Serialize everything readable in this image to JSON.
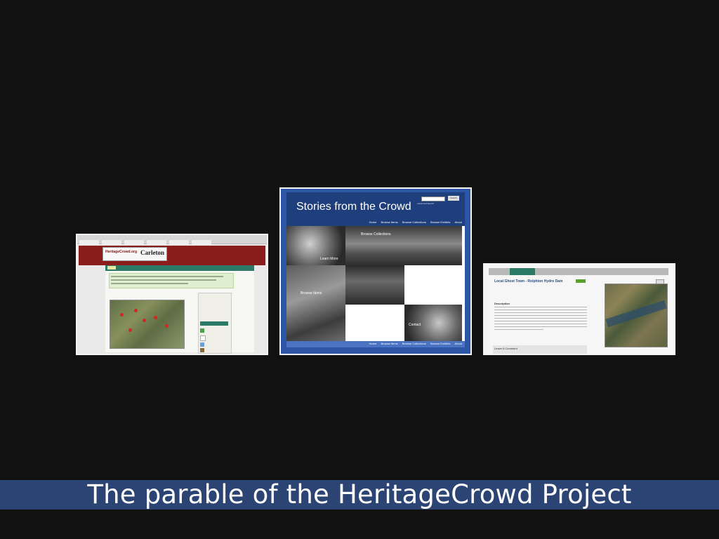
{
  "slide": {
    "caption": "The parable of the HeritageCrowd Project",
    "background_color": "#111111",
    "caption_bar_color": "#2b4474"
  },
  "left_screenshot": {
    "logo_left": "HeritageCrowd.org",
    "logo_right": "Carleton",
    "banner_color": "#8c1d1d",
    "nav_color": "#2b7a66"
  },
  "middle_screenshot": {
    "title": "Stories from the Crowd",
    "search_button": "Search",
    "advanced_search": "Advanced Search",
    "nav": [
      "Home",
      "Browse Items",
      "Browse Collections",
      "Browse Exhibits",
      "About"
    ],
    "tiles": {
      "learn_more": "Learn More",
      "browse_collections": "Browse Collections",
      "browse_items": "Browse Items",
      "contact": "Contact"
    },
    "header_color": "#1f3e7c"
  },
  "right_screenshot": {
    "post_title": "Local Ghost Town - Rolphton Hydro Dam",
    "description_heading": "Description",
    "comment_heading": "Leave A Comment",
    "nav_active_color": "#2b7a66"
  }
}
